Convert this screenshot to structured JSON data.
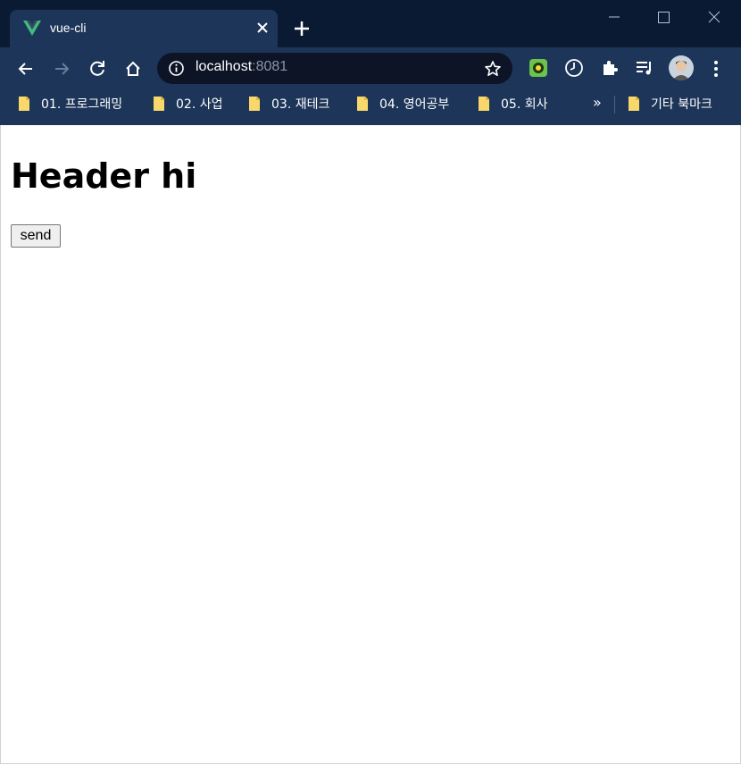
{
  "tab": {
    "title": "vue-cli",
    "favicon": "vue-logo-icon"
  },
  "window_controls": [
    "minimize-icon",
    "maximize-icon",
    "close-icon"
  ],
  "address": {
    "host": "localhost",
    "port": ":8081"
  },
  "extensions": [
    "extension-green-icon",
    "clock-icon",
    "puzzle-icon",
    "media-queue-icon"
  ],
  "bookmarks": [
    {
      "label": "01. 프로그래밍"
    },
    {
      "label": "02. 사업"
    },
    {
      "label": "03. 재테크"
    },
    {
      "label": "04. 영어공부"
    },
    {
      "label": "05. 회사"
    }
  ],
  "bookmarks_more": "»",
  "other_bookmarks": "기타 북마크",
  "page": {
    "heading": "Header hi",
    "button_label": "send"
  },
  "colors": {
    "titlebar": "#0b1a33",
    "toolbar": "#1d3558",
    "omnibox": "#0c1426",
    "vue_green": "#41b883"
  }
}
